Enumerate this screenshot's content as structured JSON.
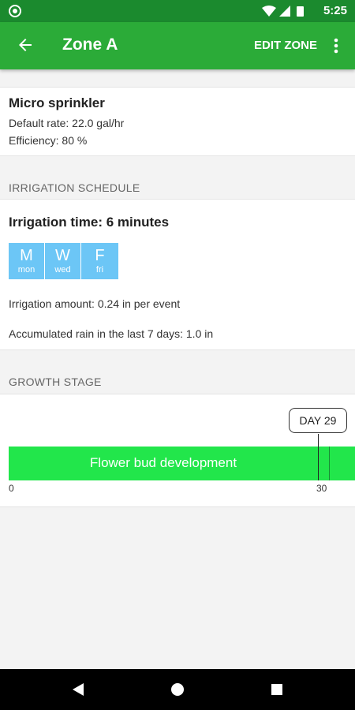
{
  "status_bar": {
    "time": "5:25"
  },
  "app_bar": {
    "title": "Zone A",
    "edit_label": "EDIT ZONE",
    "back_icon": "arrow-back-icon",
    "more_icon": "more-vert-icon"
  },
  "sprinkler": {
    "name": "Micro sprinkler",
    "rate": "Default rate: 22.0 gal/hr",
    "efficiency": "Efficiency: 80 %"
  },
  "schedule": {
    "section_title": "IRRIGATION SCHEDULE",
    "time": "Irrigation time: 6 minutes",
    "days": [
      {
        "letter": "M",
        "abbr": "mon"
      },
      {
        "letter": "W",
        "abbr": "wed"
      },
      {
        "letter": "F",
        "abbr": "fri"
      }
    ],
    "amount": "Irrigation amount: 0.24 in per event",
    "rain": "Accumulated rain in the last 7 days: 1.0 in"
  },
  "growth": {
    "section_title": "GROWTH STAGE",
    "stage_label": "Flower bud development",
    "day_label": "DAY 29",
    "tick_start": "0",
    "tick_end": "30"
  },
  "colors": {
    "status_bar": "#1b8a2e",
    "app_bar": "#2bab38",
    "day_chip": "#6cc6f6",
    "growth_bar": "#22e64b"
  }
}
